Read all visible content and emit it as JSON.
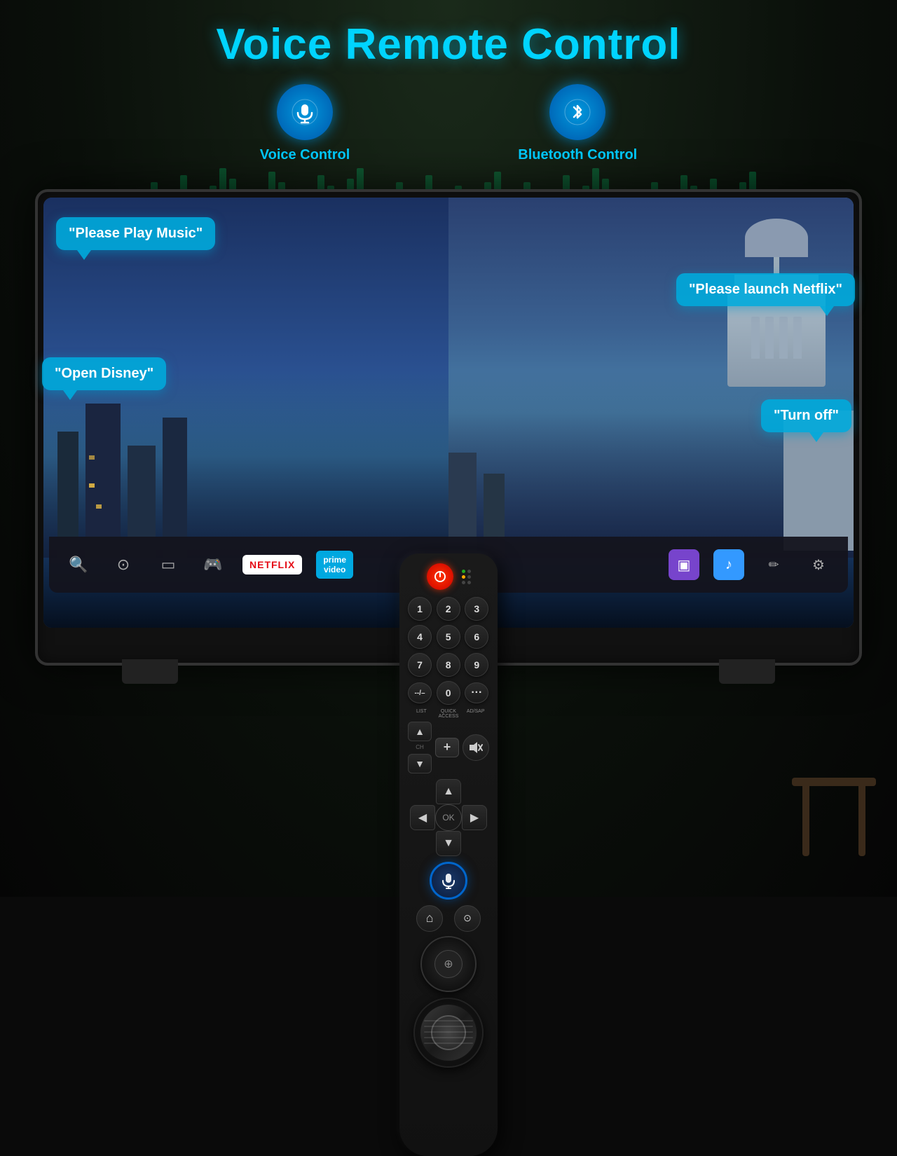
{
  "page": {
    "title": "Voice Remote Control",
    "background_color": "#0a0a0a"
  },
  "features": [
    {
      "id": "voice-control",
      "icon": "🎤",
      "label": "Voice Control"
    },
    {
      "id": "bluetooth-control",
      "icon": "🔵",
      "label": "Bluetooth Control"
    }
  ],
  "speech_bubbles": [
    {
      "id": "play-music",
      "text": "\"Please Play Music\""
    },
    {
      "id": "launch-netflix",
      "text": "\"Please launch Netflix\""
    },
    {
      "id": "open-disney",
      "text": "\"Open Disney\""
    },
    {
      "id": "turn-off",
      "text": "\"Turn off\""
    }
  ],
  "remote": {
    "power_button_label": "⏻",
    "number_keys": [
      "1",
      "2",
      "3",
      "4",
      "5",
      "6",
      "7",
      "8",
      "9"
    ],
    "special_keys": [
      "--/–",
      "0",
      "..."
    ],
    "labels": [
      "LIST",
      "QUICK\nACCESS",
      "AD/SAP"
    ],
    "nav_up": "▲",
    "nav_down": "▼",
    "nav_left": "◀",
    "nav_right": "▶",
    "mic_icon": "🎤",
    "home_icon": "⌂",
    "back_icon": "⊙"
  },
  "tv_bar": {
    "netflix_label": "NETFLIX",
    "prime_label": "prime\nvideo",
    "icons": [
      "🔍",
      "⊙",
      "▭",
      "🎮"
    ]
  }
}
